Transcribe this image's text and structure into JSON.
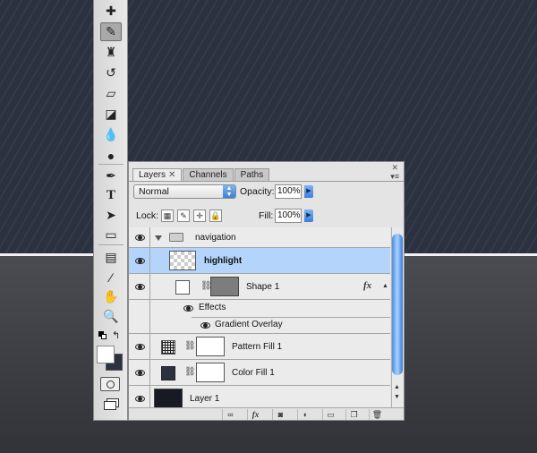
{
  "tabs": [
    {
      "label": "Layers",
      "active": true
    },
    {
      "label": "Channels",
      "active": false
    },
    {
      "label": "Paths",
      "active": false
    }
  ],
  "blend_mode": "Normal",
  "opacity_label": "Opacity:",
  "opacity_value": "100%",
  "lock_label": "Lock:",
  "fill_label": "Fill:",
  "fill_value": "100%",
  "layers": [
    {
      "name": "navigation",
      "kind": "group",
      "visible": true
    },
    {
      "name": "highlight",
      "kind": "layer",
      "visible": true,
      "selected": true
    },
    {
      "name": "Shape 1",
      "kind": "shape",
      "visible": true,
      "has_fx": true
    },
    {
      "name": "Effects",
      "kind": "effects-header",
      "visible": true
    },
    {
      "name": "Gradient Overlay",
      "kind": "effect",
      "visible": true
    },
    {
      "name": "Pattern Fill 1",
      "kind": "fill",
      "visible": true
    },
    {
      "name": "Color Fill 1",
      "kind": "fill",
      "visible": true
    },
    {
      "name": "Layer 1",
      "kind": "layer",
      "visible": true
    }
  ],
  "fx_badge": "fx",
  "bottom_bar_fx": "fx",
  "colors": {
    "canvas_top": "#2c3140",
    "canvas_bottom": "#3e3f44",
    "foreground": "#ffffff",
    "background": "#2d3240",
    "selection": "#b5d4fb"
  },
  "tools": [
    "healing-brush",
    "brush",
    "clone-stamp",
    "history-brush",
    "eraser",
    "paint-bucket",
    "blur",
    "dodge",
    "pen",
    "type",
    "path-selection",
    "rectangle",
    "notes",
    "eyedropper",
    "hand",
    "zoom"
  ],
  "text_tool_glyph": "T"
}
